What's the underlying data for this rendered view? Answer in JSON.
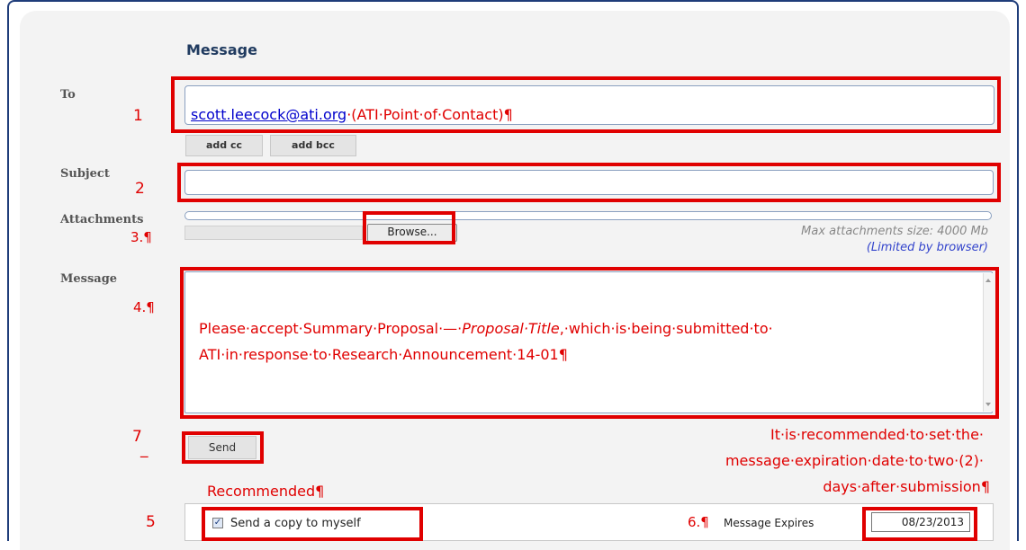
{
  "form": {
    "title": "Message",
    "to": {
      "label": "To",
      "email": "scott.leecock@ati.org",
      "contact_note": "·(ATI·Point·of·Contact)¶",
      "add_cc": "add cc",
      "add_bcc": "add bcc"
    },
    "subject": {
      "label": "Subject",
      "value": ""
    },
    "attachments": {
      "label": "Attachments",
      "browse": "Browse...",
      "max_size": "Max attachments size: 4000 Mb",
      "limited": "(Limited by browser)"
    },
    "message": {
      "label": "Message",
      "line1_a": "Please·accept·Summary·Proposal·—·",
      "line1_b": "Proposal·Title",
      "line1_c": ",·which·is·being·submitted·to·",
      "line2": "ATI·in·response·to·Research·Announcement·14-01¶"
    },
    "send": "Send",
    "send_copy": "Send a copy to myself",
    "expires": {
      "label": "Message Expires",
      "value": "08/23/2013"
    }
  },
  "annotations": {
    "n1": "1",
    "n2": "2",
    "n3": "3.¶",
    "n4": "4.¶",
    "n5": "5",
    "n6": "6.¶",
    "n7": "7",
    "n7_underscore": "_",
    "recommended": "Recommended¶",
    "note_line1": "It·is·recommended·to·set·the·",
    "note_line2": "message·expiration·date·to·two·(2)·",
    "note_line3": "days·after·submission¶"
  },
  "colors": {
    "annotation_red": "#e00000",
    "heading_blue": "#1f3a5f",
    "frame_blue": "#1f3d7a",
    "link_blue": "#0000cc"
  }
}
